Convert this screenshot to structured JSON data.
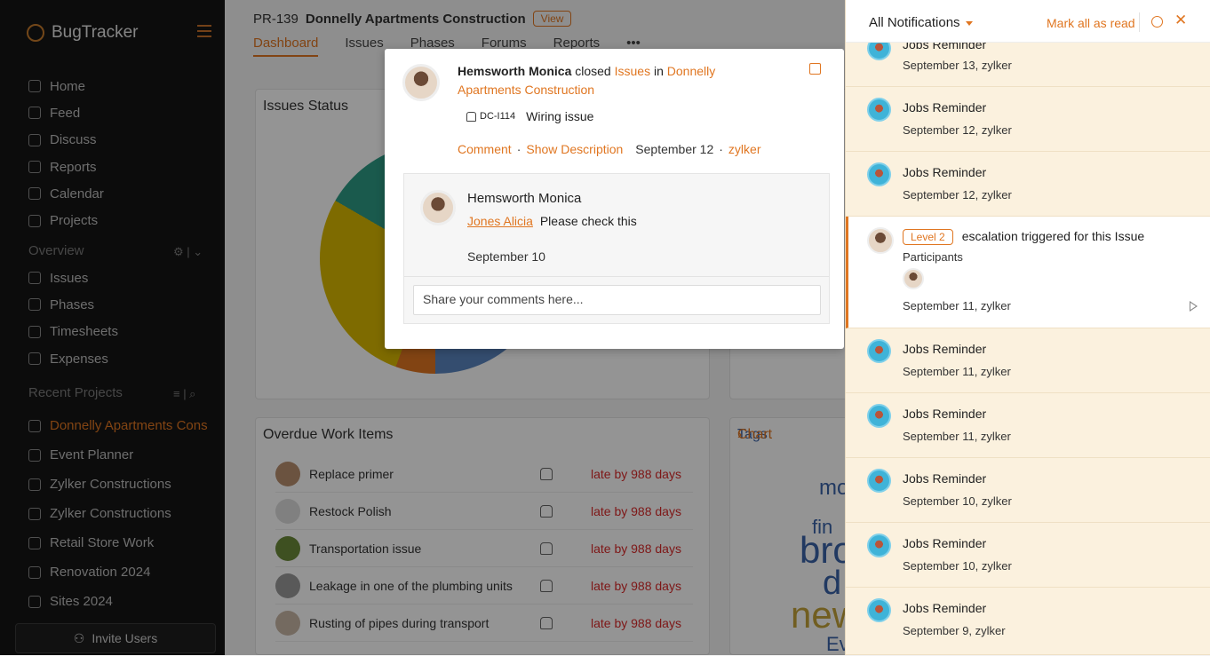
{
  "app": {
    "name": "BugTracker"
  },
  "sidebar": {
    "nav": [
      "Home",
      "Feed",
      "Discuss",
      "Reports",
      "Calendar",
      "Projects"
    ],
    "overview_title": "Overview",
    "overview": [
      "Issues",
      "Phases",
      "Timesheets",
      "Expenses"
    ],
    "recent_title": "Recent Projects",
    "recent": [
      "Donnelly Apartments Cons",
      "Event Planner",
      "Zylker Constructions",
      "Zylker Constructions",
      "Retail Store Work",
      "Renovation 2024",
      "Sites 2024"
    ],
    "invite_label": "Invite Users"
  },
  "project": {
    "id": "PR-139",
    "name": "Donnelly Apartments Construction",
    "view_label": "View",
    "tabs": [
      "Dashboard",
      "Issues",
      "Phases",
      "Forums",
      "Reports",
      "•••"
    ]
  },
  "dashboard": {
    "issues_status_title": "Issues Status",
    "overdue_title": "Overdue Work Items",
    "tags_title": "Tags",
    "tags_chart_label": "Chart",
    "overdue": [
      {
        "name": "Replace primer",
        "late": "late by 988 days"
      },
      {
        "name": "Restock Polish",
        "late": "late by 988 days"
      },
      {
        "name": "Transportation issue",
        "late": "late by 988 days"
      },
      {
        "name": "Leakage in one of the plumbing units",
        "late": "late by 988 days"
      },
      {
        "name": "Rusting of pipes during transport",
        "late": "late by 988 days"
      }
    ],
    "tag_words": [
      "mo",
      "fin",
      "bro",
      "d",
      "new",
      "Ev"
    ]
  },
  "popup": {
    "actor": "Hemsworth Monica",
    "verb": "closed",
    "module": "Issues",
    "in_word": "in",
    "project": "Donnelly Apartments Construction",
    "issue_id": "DC-I114",
    "issue_title": "Wiring issue",
    "comment_action": "Comment",
    "show_desc_action": "Show Description",
    "date": "September 12",
    "by": "zylker",
    "comment": {
      "author": "Hemsworth Monica",
      "mention": "Jones Alicia",
      "text": "Please check this",
      "date": "September 10"
    },
    "input_placeholder": "Share your comments here..."
  },
  "notifications": {
    "title": "All Notifications",
    "mark_all": "Mark all as read",
    "items": [
      {
        "title": "Jobs Reminder",
        "meta": "September 13, zylker"
      },
      {
        "title": "Jobs Reminder",
        "meta": "September 12, zylker"
      },
      {
        "title": "Jobs Reminder",
        "meta": "September 12, zylker"
      },
      {
        "level": "Level 2",
        "title": "escalation triggered for this Issue",
        "participants": "Participants",
        "meta": "September 11, zylker"
      },
      {
        "title": "Jobs Reminder",
        "meta": "September 11, zylker"
      },
      {
        "title": "Jobs Reminder",
        "meta": "September 11, zylker"
      },
      {
        "title": "Jobs Reminder",
        "meta": "September 10, zylker"
      },
      {
        "title": "Jobs Reminder",
        "meta": "September 10, zylker"
      },
      {
        "title": "Jobs Reminder",
        "meta": "September 9, zylker"
      }
    ]
  },
  "colors": {
    "accent": "#e07621",
    "sidebar_bg": "#161616",
    "notif_bg": "#fbf1de",
    "late": "#d92a2a"
  }
}
